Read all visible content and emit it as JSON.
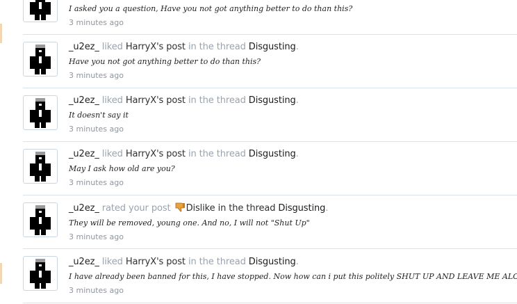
{
  "feed": {
    "items": [
      {
        "user": "",
        "verb": "",
        "object_link": "",
        "object_suffix": "",
        "rating": "",
        "in_text": "",
        "thread": "",
        "dot": "",
        "snippet": "I asked you a question, Have you not got anything better to do than this?",
        "time": "3 minutes ago"
      },
      {
        "user": "_u2ez_",
        "verb": "liked",
        "object_link": "HarryX's post",
        "object_suffix": "",
        "rating": "",
        "in_text": "in the thread",
        "thread": "Disgusting",
        "dot": ".",
        "snippet": "Have you not got anything better to do than this?",
        "time": "3 minutes ago"
      },
      {
        "user": "_u2ez_",
        "verb": "liked",
        "object_link": "HarryX's post",
        "object_suffix": "",
        "rating": "",
        "in_text": "in the thread",
        "thread": "Disgusting",
        "dot": ".",
        "snippet": "It doesn't say it",
        "time": "3 minutes ago"
      },
      {
        "user": "_u2ez_",
        "verb": "liked",
        "object_link": "HarryX's post",
        "object_suffix": "",
        "rating": "",
        "in_text": "in the thread",
        "thread": "Disgusting",
        "dot": ".",
        "snippet": "May I ask how old are you?",
        "time": "3 minutes ago"
      },
      {
        "user": "_u2ez_",
        "verb": "rated your post",
        "object_link": "",
        "object_suffix": "",
        "rating": "Dislike",
        "in_text": "in the thread",
        "thread": "Disgusting",
        "dot": ".",
        "snippet": "They will be removed, young one. And no, I will not \"Shut Up\"",
        "time": "3 minutes ago"
      },
      {
        "user": "_u2ez_",
        "verb": "liked",
        "object_link": "HarryX's post",
        "object_suffix": "",
        "rating": "",
        "in_text": "in the thread",
        "thread": "Disgusting",
        "dot": ".",
        "snippet": "I have already been banned for this, I have stopped. Now how can i put this politely SHUT UP AND LEAVE ME ALONE",
        "time": "3 minutes ago"
      }
    ]
  },
  "colors": {
    "border": "#d7e3ee",
    "muted_text": "#9aa3ad",
    "accent_tab": "#f3d6b4"
  }
}
